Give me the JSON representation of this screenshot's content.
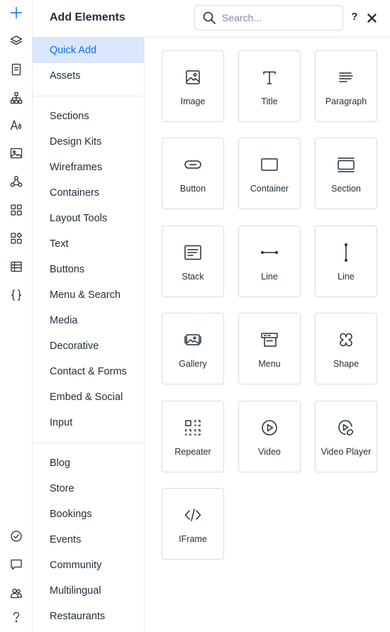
{
  "header": {
    "title": "Add Elements",
    "search_placeholder": "Search...",
    "help_label": "?"
  },
  "rail": [
    {
      "icon": "plus-icon",
      "active": true
    },
    {
      "icon": "layers-icon"
    },
    {
      "icon": "page-icon"
    },
    {
      "icon": "site-structure-icon"
    },
    {
      "icon": "theme-icon"
    },
    {
      "icon": "media-icon"
    },
    {
      "icon": "apps-network-icon"
    },
    {
      "icon": "app-grid-icon"
    },
    {
      "icon": "business-apps-icon"
    },
    {
      "icon": "cms-table-icon"
    },
    {
      "icon": "code-braces-icon"
    },
    {
      "icon": "checkmark-circle-icon"
    },
    {
      "icon": "chat-icon"
    },
    {
      "icon": "members-icon"
    },
    {
      "icon": "help-icon"
    }
  ],
  "categories": {
    "group1": [
      "Quick Add",
      "Assets"
    ],
    "group2": [
      "Sections",
      "Design Kits",
      "Wireframes",
      "Containers",
      "Layout Tools",
      "Text",
      "Buttons",
      "Menu & Search",
      "Media",
      "Decorative",
      "Contact & Forms",
      "Embed & Social",
      "Input"
    ],
    "group3": [
      "Blog",
      "Store",
      "Bookings",
      "Events",
      "Community",
      "Multilingual",
      "Restaurants"
    ],
    "selected": "Quick Add"
  },
  "tiles": [
    {
      "label": "Image",
      "icon": "image-icon"
    },
    {
      "label": "Title",
      "icon": "title-text-icon"
    },
    {
      "label": "Paragraph",
      "icon": "paragraph-icon"
    },
    {
      "label": "Button",
      "icon": "button-icon"
    },
    {
      "label": "Container",
      "icon": "container-icon"
    },
    {
      "label": "Section",
      "icon": "section-icon"
    },
    {
      "label": "Stack",
      "icon": "stack-icon"
    },
    {
      "label": "Line",
      "icon": "horizontal-line-icon"
    },
    {
      "label": "Line",
      "icon": "vertical-line-icon"
    },
    {
      "label": "Gallery",
      "icon": "gallery-icon"
    },
    {
      "label": "Menu",
      "icon": "menu-icon"
    },
    {
      "label": "Shape",
      "icon": "shape-icon"
    },
    {
      "label": "Repeater",
      "icon": "repeater-icon"
    },
    {
      "label": "Video",
      "icon": "video-icon"
    },
    {
      "label": "Video Player",
      "icon": "video-player-icon"
    },
    {
      "label": "IFrame",
      "icon": "iframe-code-icon"
    }
  ],
  "colors": {
    "accent": "#116dff",
    "selected_bg": "#d9e6fc",
    "text": "#20303c",
    "border": "#d6dbe1"
  }
}
